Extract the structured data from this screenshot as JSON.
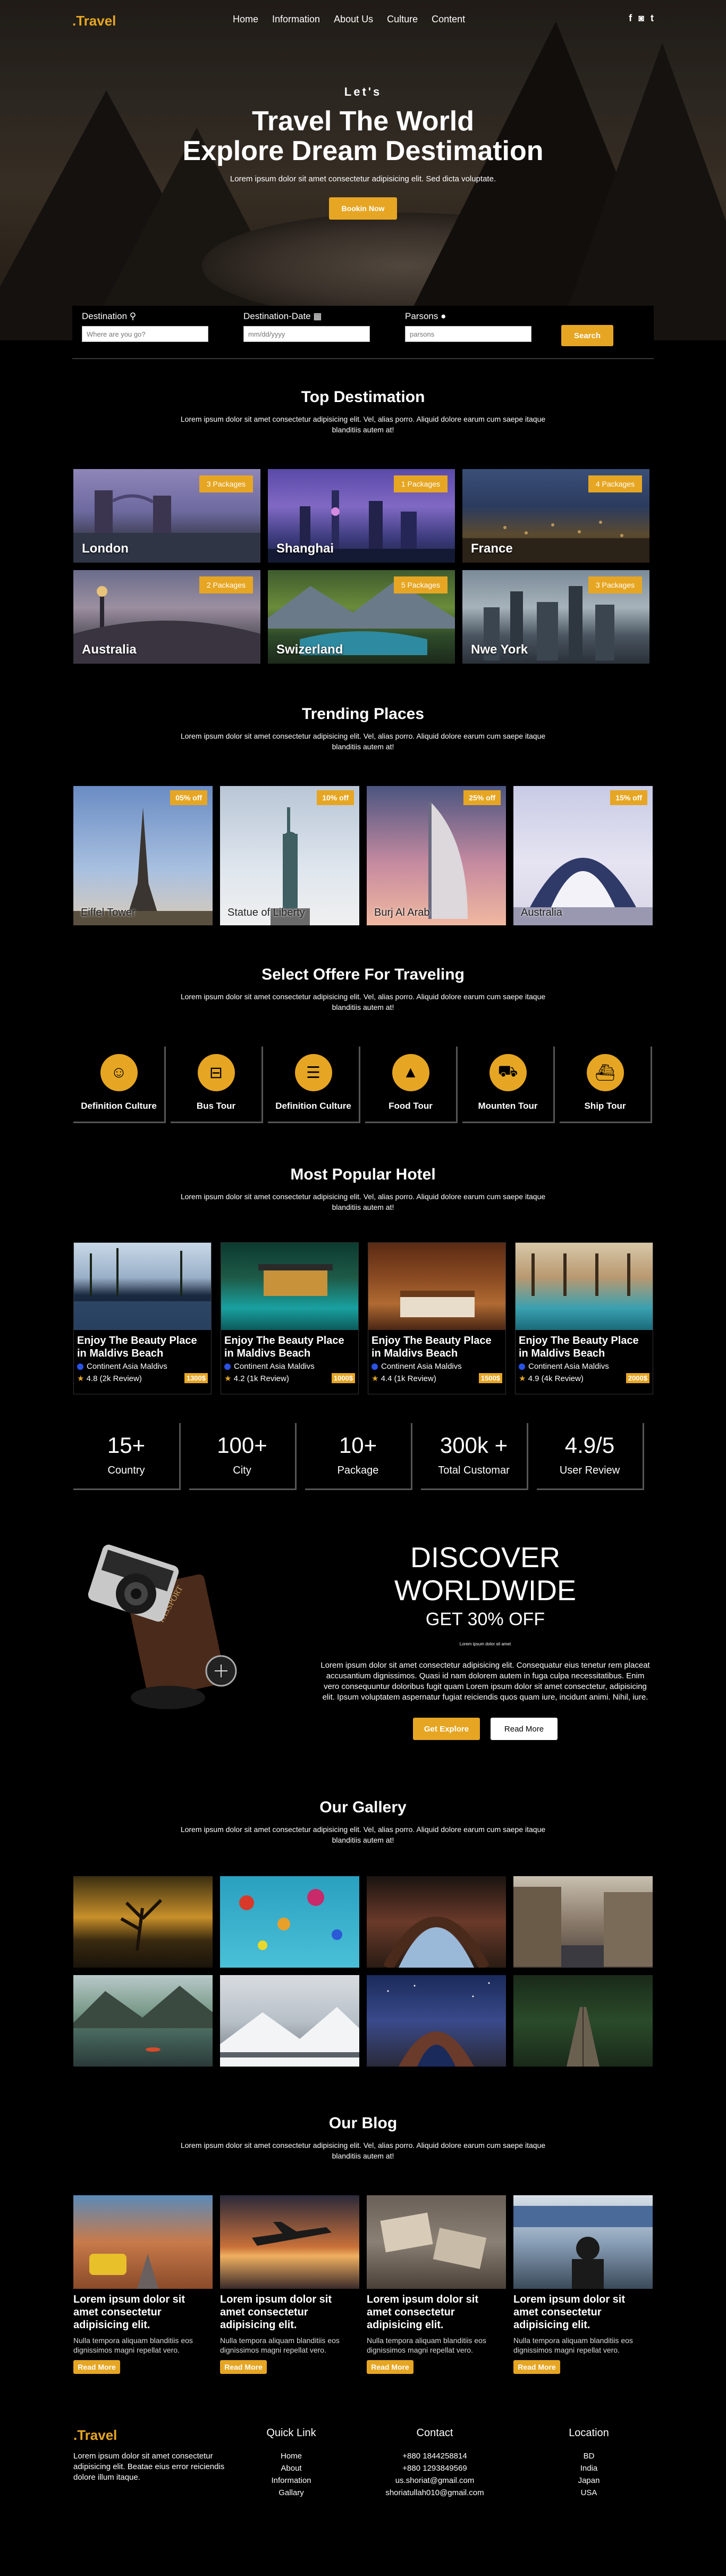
{
  "nav": {
    "logo": ".Travel",
    "menu": [
      "Home",
      "Information",
      "About Us",
      "Culture",
      "Content"
    ],
    "social": [
      "f",
      "◙",
      "t"
    ]
  },
  "hero": {
    "kicker": "Let's",
    "title_line1": "Travel The World",
    "title_line2": "Explore Dream Destimation",
    "subtitle": "Lorem ipsum dolor sit amet consectetur adipisicing elit. Sed dicta voluptate.",
    "cta": "Bookin Now"
  },
  "search": {
    "destination_label": "Destination",
    "destination_placeholder": "Where are you go?",
    "date_label": "Destination-Date",
    "date_placeholder": "mm/dd/yyyy",
    "persons_label": "Parsons",
    "persons_placeholder": "parsons",
    "button": "Search"
  },
  "lorem": "Lorem ipsum dolor sit amet consectetur adipisicing elit. Vel, alias porro. Aliquid dolore earum cum saepe itaque blanditiis autem at!",
  "destinations": {
    "title": "Top Destimation",
    "items": [
      {
        "city": "London",
        "packages": "3 Packages"
      },
      {
        "city": "Shanghai",
        "packages": "1 Packages"
      },
      {
        "city": "France",
        "packages": "4 Packages"
      },
      {
        "city": "Australia",
        "packages": "2 Packages"
      },
      {
        "city": "Swizerland",
        "packages": "5 Packages"
      },
      {
        "city": "Nwe York",
        "packages": "3 Packages"
      }
    ]
  },
  "trending": {
    "title": "Trending Places",
    "items": [
      {
        "name": "Eiffel Tower",
        "off": "05% off"
      },
      {
        "name": "Statue of Liberty",
        "off": "10% off"
      },
      {
        "name": "Burj Al Arab",
        "off": "25% off"
      },
      {
        "name": "Australia",
        "off": "15% off"
      }
    ]
  },
  "offers": {
    "title": "Select Offere For Traveling",
    "items": [
      {
        "label": "Definition Culture",
        "icon": "smile-icon"
      },
      {
        "label": "Bus Tour",
        "icon": "bus-icon"
      },
      {
        "label": "Definition Culture",
        "icon": "burger-icon"
      },
      {
        "label": "Food Tour",
        "icon": "mountain-icon"
      },
      {
        "label": "Mounten Tour",
        "icon": "truck-icon"
      },
      {
        "label": "Ship Tour",
        "icon": "ship-icon"
      }
    ]
  },
  "hotels": {
    "title": "Most Popular Hotel",
    "items": [
      {
        "title": "Enjoy The Beauty Place in Maldivs Beach",
        "location": "Continent Asia Maldivs",
        "review": "4.8 (2k Review)",
        "price": "1300$"
      },
      {
        "title": "Enjoy The Beauty Place in Maldivs Beach",
        "location": "Continent Asia Maldivs",
        "review": "4.2 (1k Review)",
        "price": "1000$"
      },
      {
        "title": "Enjoy The Beauty Place in Maldivs Beach",
        "location": "Continent Asia Maldivs",
        "review": "4.4 (1k Review)",
        "price": "1500$"
      },
      {
        "title": "Enjoy The Beauty Place in Maldivs Beach",
        "location": "Continent Asia Maldivs",
        "review": "4.9 (4k Review)",
        "price": "2000$"
      }
    ]
  },
  "stats": [
    {
      "number": "15+",
      "label": "Country"
    },
    {
      "number": "100+",
      "label": "City"
    },
    {
      "number": "10+",
      "label": "Package"
    },
    {
      "number": "300k +",
      "label": "Total Customar"
    },
    {
      "number": "4.9/5",
      "label": "User Review"
    }
  ],
  "discover": {
    "title": "DISCOVER WORLDWIDE",
    "subtitle": "GET 30% OFF",
    "small": "Lorem ipsum dolor sit amet",
    "paragraph": "Lorem ipsum dolor sit amet consectetur adipisicing elit. Consequatur eius tenetur rem placeat accusantium dignissimos. Quasi id nam dolorem autem in fuga culpa necessitatibus. Enim vero consequuntur doloribus fugit quam Lorem ipsum dolor sit amet consectetur, adipisicing elit. Ipsum voluptatem aspernatur fugiat reiciendis quos quam iure, incidunt animi. Nihil, iure.",
    "btn1": "Get Explore",
    "btn2": "Read More"
  },
  "gallery": {
    "title": "Our Gallery"
  },
  "blog": {
    "title": "Our Blog",
    "items": [
      {
        "title": "Lorem ipsum dolor sit amet consectetur adipisicing elit.",
        "text": "Nulla tempora aliquam blanditiis eos dignissimos magni repellat vero.",
        "button": "Read More"
      },
      {
        "title": "Lorem ipsum dolor sit amet consectetur adipisicing elit.",
        "text": "Nulla tempora aliquam blanditiis eos dignissimos magni repellat vero.",
        "button": "Read More"
      },
      {
        "title": "Lorem ipsum dolor sit amet consectetur adipisicing elit.",
        "text": "Nulla tempora aliquam blanditiis eos dignissimos magni repellat vero.",
        "button": "Read More"
      },
      {
        "title": "Lorem ipsum dolor sit amet consectetur adipisicing elit.",
        "text": "Nulla tempora aliquam blanditiis eos dignissimos magni repellat vero.",
        "button": "Read More"
      }
    ]
  },
  "footer": {
    "logo": ".Travel",
    "about": "Lorem ipsum dolor sit amet consectetur adipisicing elit. Beatae eius error reiciendis dolore illum itaque.",
    "quick_title": "Quick Link",
    "quick": [
      "Home",
      "About",
      "Information",
      "Gallary"
    ],
    "contact_title": "Contact",
    "contact": [
      "+880 1844258814",
      "+880 1293849569",
      "us.shoriat@gmail.com",
      "shoriatullah010@gmail.com"
    ],
    "location_title": "Location",
    "location": [
      "BD",
      "India",
      "Japan",
      "USA"
    ]
  },
  "colors": {
    "accent": "#e6a623",
    "background": "#000000"
  }
}
